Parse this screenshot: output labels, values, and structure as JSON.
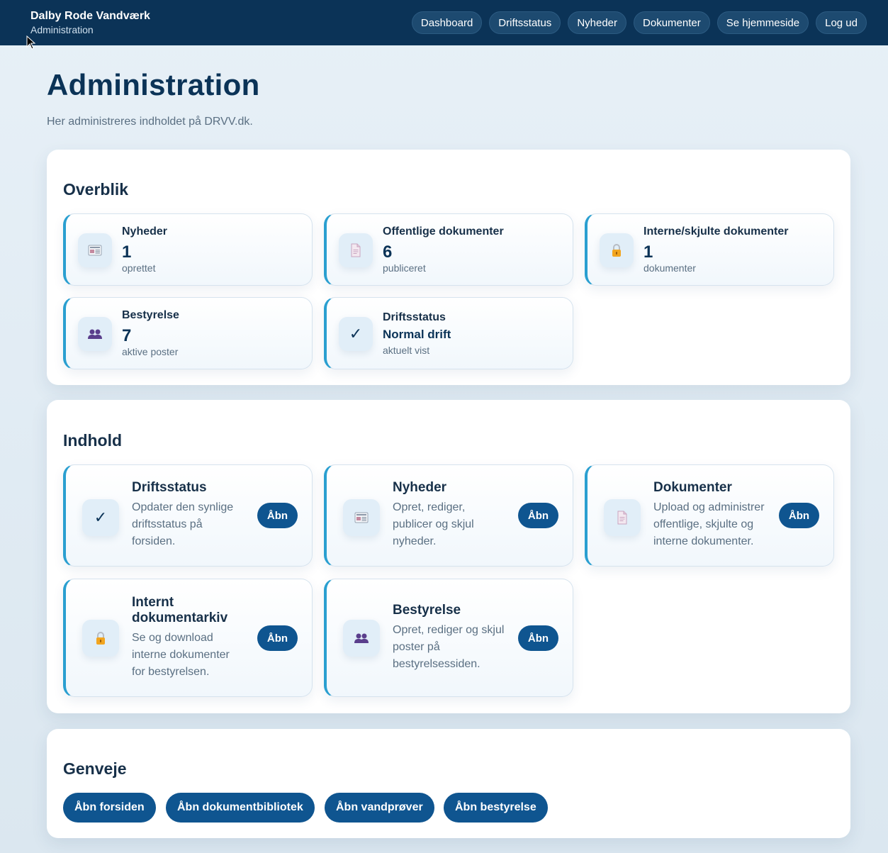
{
  "header": {
    "brand_title": "Dalby Rode Vandværk",
    "brand_subtitle": "Administration",
    "nav": [
      "Dashboard",
      "Driftsstatus",
      "Nyheder",
      "Dokumenter",
      "Se hjemmeside",
      "Log ud"
    ]
  },
  "page": {
    "title": "Administration",
    "subtitle": "Her administreres indholdet på DRVV.dk."
  },
  "overview": {
    "title": "Overblik",
    "stats": [
      {
        "label": "Nyheder",
        "value": "1",
        "note": "oprettet",
        "icon": "newspaper-icon"
      },
      {
        "label": "Offentlige dokumenter",
        "value": "6",
        "note": "publiceret",
        "icon": "document-icon"
      },
      {
        "label": "Interne/skjulte dokumenter",
        "value": "1",
        "note": "dokumenter",
        "icon": "lock-icon"
      },
      {
        "label": "Bestyrelse",
        "value": "7",
        "note": "aktive poster",
        "icon": "people-icon"
      },
      {
        "label": "Driftsstatus",
        "value": "Normal drift",
        "note": "aktuelt vist",
        "icon": "check-icon"
      }
    ]
  },
  "content": {
    "title": "Indhold",
    "cards": [
      {
        "title": "Driftsstatus",
        "desc_lines": [
          "Opdater den synlige",
          "driftsstatus på",
          "forsiden."
        ],
        "button": "Åbn",
        "icon": "check-icon"
      },
      {
        "title": "Nyheder",
        "desc_lines": [
          "Opret, rediger,",
          "publicer og skjul",
          "nyheder."
        ],
        "button": "Åbn",
        "icon": "newspaper-icon"
      },
      {
        "title": "Dokumenter",
        "desc_lines": [
          "Upload og administrer",
          "offentlige, skjulte og",
          "interne dokumenter."
        ],
        "button": "Åbn",
        "icon": "document-icon"
      },
      {
        "title_lines": [
          "Internt",
          "dokumentarkiv"
        ],
        "desc_lines": [
          "Se og download",
          "interne dokumenter",
          "for bestyrelsen."
        ],
        "button": "Åbn",
        "icon": "lock-icon"
      },
      {
        "title": "Bestyrelse",
        "desc_lines": [
          "Opret, rediger og skjul",
          "poster på",
          "bestyrelsessiden."
        ],
        "button": "Åbn",
        "icon": "people-icon"
      }
    ]
  },
  "shortcuts": {
    "title": "Genveje",
    "buttons": [
      "Åbn forsiden",
      "Åbn dokumentbibliotek",
      "Åbn vandprøver",
      "Åbn bestyrelse"
    ]
  },
  "colors": {
    "header_bg": "#0b3357",
    "accent": "#2a9fd0",
    "button": "#0f5590"
  }
}
